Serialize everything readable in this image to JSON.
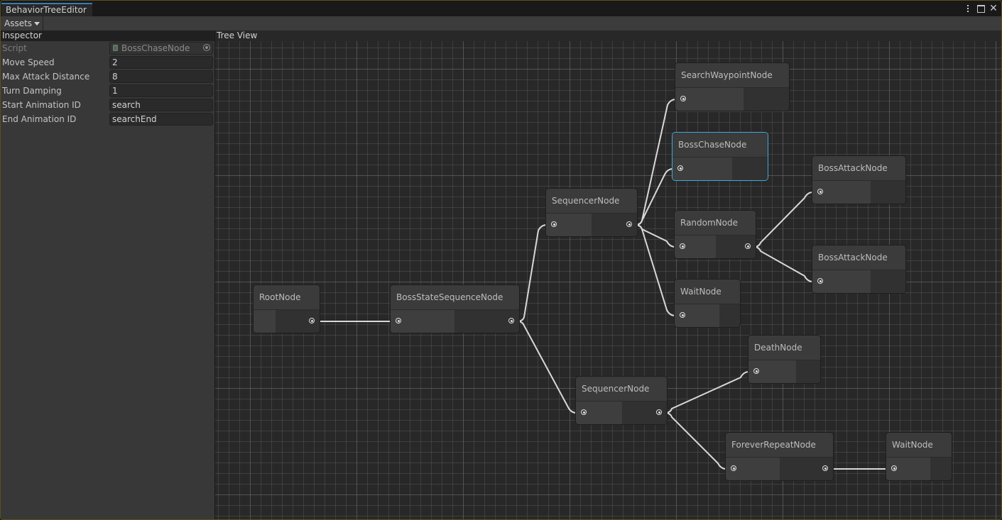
{
  "window": {
    "tab_title": "BehaviorTreeEditor",
    "controls": [
      "more-options",
      "maximize",
      "close"
    ]
  },
  "toolbar": {
    "assets_label": "Assets"
  },
  "inspector": {
    "title": "Inspector",
    "script": {
      "label": "Script",
      "value": "BossChaseNode"
    },
    "properties": [
      {
        "label": "Move Speed",
        "value": "2"
      },
      {
        "label": "Max Attack Distance",
        "value": "8"
      },
      {
        "label": "Turn Damping",
        "value": "1"
      },
      {
        "label": "Start Animation ID",
        "value": "search"
      },
      {
        "label": "End Animation ID",
        "value": "searchEnd"
      }
    ]
  },
  "tree_view": {
    "title": "Tree View",
    "selected_node": "boss-chase",
    "nodes": [
      {
        "id": "root",
        "title": "RootNode",
        "has_input": false,
        "has_output": true
      },
      {
        "id": "boss-state-seq",
        "title": "BossStateSequenceNode",
        "has_input": true,
        "has_output": true
      },
      {
        "id": "seq-top",
        "title": "SequencerNode",
        "has_input": true,
        "has_output": true
      },
      {
        "id": "search-waypoint",
        "title": "SearchWaypointNode",
        "has_input": true,
        "has_output": false
      },
      {
        "id": "boss-chase",
        "title": "BossChaseNode",
        "has_input": true,
        "has_output": false
      },
      {
        "id": "random",
        "title": "RandomNode",
        "has_input": true,
        "has_output": true
      },
      {
        "id": "wait-top",
        "title": "WaitNode",
        "has_input": true,
        "has_output": false
      },
      {
        "id": "boss-attack-1",
        "title": "BossAttackNode",
        "has_input": true,
        "has_output": false
      },
      {
        "id": "boss-attack-2",
        "title": "BossAttackNode",
        "has_input": true,
        "has_output": false
      },
      {
        "id": "seq-bottom",
        "title": "SequencerNode",
        "has_input": true,
        "has_output": true
      },
      {
        "id": "death",
        "title": "DeathNode",
        "has_input": true,
        "has_output": false
      },
      {
        "id": "forever-repeat",
        "title": "ForeverRepeatNode",
        "has_input": true,
        "has_output": true
      },
      {
        "id": "wait-bottom",
        "title": "WaitNode",
        "has_input": true,
        "has_output": false
      }
    ],
    "edges": [
      [
        "root",
        "boss-state-seq"
      ],
      [
        "boss-state-seq",
        "seq-top"
      ],
      [
        "boss-state-seq",
        "seq-bottom"
      ],
      [
        "seq-top",
        "search-waypoint"
      ],
      [
        "seq-top",
        "boss-chase"
      ],
      [
        "seq-top",
        "random"
      ],
      [
        "seq-top",
        "wait-top"
      ],
      [
        "random",
        "boss-attack-1"
      ],
      [
        "random",
        "boss-attack-2"
      ],
      [
        "seq-bottom",
        "death"
      ],
      [
        "seq-bottom",
        "forever-repeat"
      ],
      [
        "forever-repeat",
        "wait-bottom"
      ]
    ],
    "colors": {
      "selection": "#44a6dd",
      "edge": "#d8d8d8"
    }
  }
}
